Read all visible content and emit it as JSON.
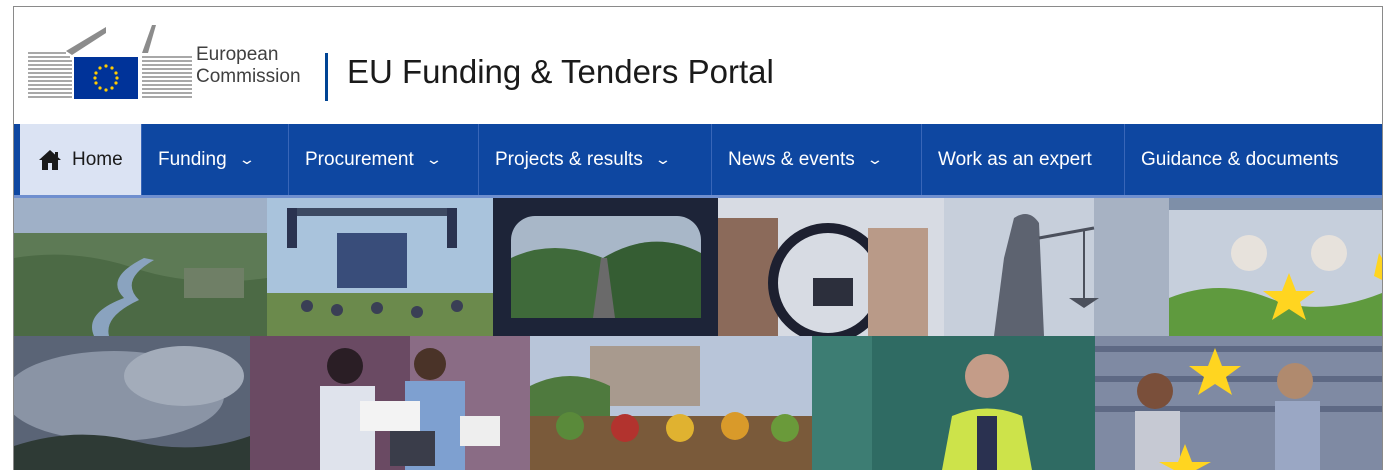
{
  "header": {
    "logo_line1": "European",
    "logo_line2": "Commission",
    "portal_title": "EU Funding & Tenders Portal"
  },
  "nav": {
    "home": "Home",
    "funding": "Funding",
    "procurement": "Procurement",
    "projects": "Projects & results",
    "news": "News & events",
    "expert": "Work as an expert",
    "guidance": "Guidance & documents"
  },
  "icons": {
    "home": "home-icon",
    "dropdown": "chevron-down-icon"
  },
  "colors": {
    "nav_background": "#0e47a1",
    "nav_active": "#dbe3f3",
    "eu_blue": "#003399",
    "eu_yellow": "#ffcc00"
  }
}
